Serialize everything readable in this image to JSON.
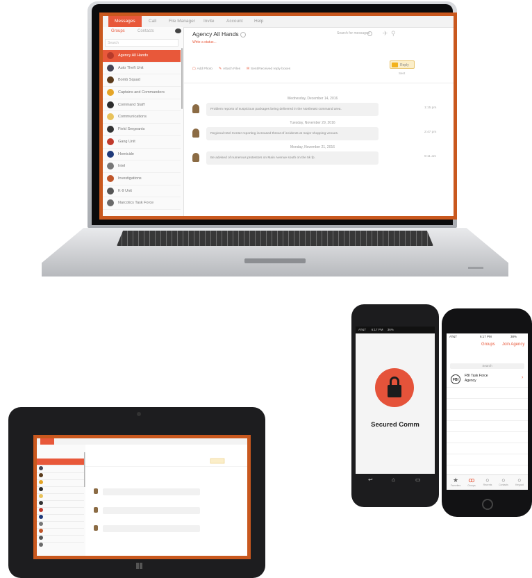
{
  "app": {
    "tabs": [
      "Messages",
      "Call",
      "File Manager",
      "Invite",
      "Account",
      "Help"
    ],
    "sidebar_tabs": [
      "Groups",
      "Contacts"
    ],
    "search_placeholder": "Search",
    "groups": [
      {
        "label": "Agency All Hands",
        "color": "#b63a2a"
      },
      {
        "label": "Auto Theft Unit",
        "color": "#445"
      },
      {
        "label": "Bomb Squad",
        "color": "#5a3b1b"
      },
      {
        "label": "Captains and Commanders",
        "color": "#e5a526"
      },
      {
        "label": "Command Staff",
        "color": "#2c2c2c"
      },
      {
        "label": "Communications",
        "color": "#e8c25b"
      },
      {
        "label": "Field Sergeants",
        "color": "#333"
      },
      {
        "label": "Gang Unit",
        "color": "#c0392b"
      },
      {
        "label": "Homicide",
        "color": "#1f3a7a"
      },
      {
        "label": "Intel",
        "color": "#777"
      },
      {
        "label": "Investigations",
        "color": "#c0562a"
      },
      {
        "label": "K-9 Unit",
        "color": "#555"
      },
      {
        "label": "Narcotics Task Force",
        "color": "#6a6a6a"
      }
    ],
    "conversation_title": "Agency All Hands",
    "message_search": "Search for messages",
    "status_link": "Write a status...",
    "actions": [
      "Add Photo",
      "Attach Files",
      "Sent/Received reply boxes"
    ],
    "reply_label": "Reply",
    "send_label": "Sent",
    "messages": [
      {
        "date": "Wednesday, December 14, 2016",
        "text": "Problem reports of suspicious packages being delivered in the Northeast command area.",
        "time": "1:15 pm"
      },
      {
        "date": "Tuesday, November 29, 2016",
        "text": "Regional Intel Center reporting increased threat of incidents at major shopping venues.",
        "time": "2:47 pm"
      },
      {
        "date": "Monday, November 21, 2016",
        "text": "Be advised of numerous protestors on Main Avenue south on the 5k fp.",
        "time": "9:11 am"
      }
    ]
  },
  "android": {
    "status": "AT&T",
    "status_time": "6:17 PM",
    "status_batt": "36%",
    "brand": "Secured Comm"
  },
  "iphone": {
    "status": "AT&T",
    "status_time": "6:17 PM",
    "status_batt": "38%",
    "nav_title": "Groups",
    "nav_action": "Join Agency",
    "search": "Search",
    "row_title": "FBI Task Force",
    "row_subtitle": "Agency",
    "row_badge": "FBI",
    "tabs": [
      "Favorites",
      "Groups",
      "Recents",
      "Contacts",
      "Keypad"
    ]
  }
}
